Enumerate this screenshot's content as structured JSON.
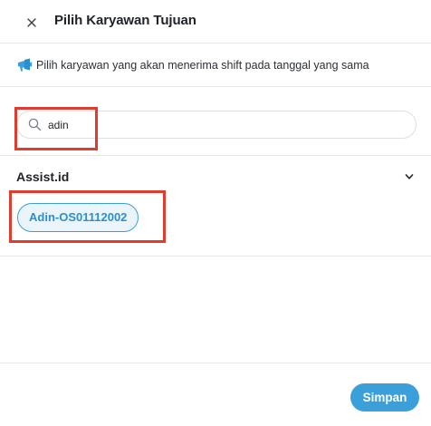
{
  "header": {
    "title": "Pilih Karyawan Tujuan",
    "close_icon": "close-icon"
  },
  "info": {
    "icon": "megaphone-icon",
    "text": "Pilih karyawan yang akan menerima shift pada tanggal yang sama"
  },
  "search": {
    "icon": "search-icon",
    "value": "adin",
    "placeholder": ""
  },
  "groups": [
    {
      "name": "Assist.id",
      "expanded": true,
      "employees": [
        {
          "label": "Adin-OS01112002"
        }
      ]
    }
  ],
  "footer": {
    "save_label": "Simpan"
  },
  "colors": {
    "accent": "#3b9fd9",
    "chip_bg": "#e9f4fb",
    "highlight": "#e03b2f",
    "divider": "#e6e8eb"
  }
}
